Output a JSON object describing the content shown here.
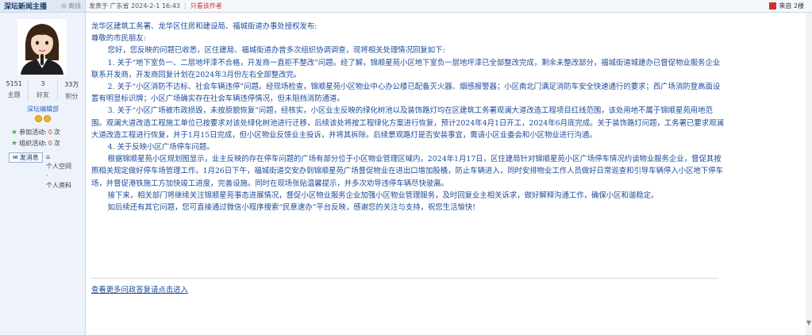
{
  "user": {
    "name": "深坛新闻主播",
    "status": "离线",
    "stats": [
      {
        "value": "5151",
        "label": "主题"
      },
      {
        "value": "3",
        "label": "好友"
      },
      {
        "value": "33万",
        "label": "积分"
      }
    ],
    "rank": "深坛编辑部",
    "activity1_label": "参加活动:",
    "activity1_value": "0",
    "activity1_unit": "次",
    "activity2_label": "组织活动:",
    "activity2_value": "0",
    "activity2_unit": "次",
    "message_button": "发消息",
    "space_link": "个人空间",
    "profile_link": "个人资料"
  },
  "topbar": {
    "posted": "发表于 广东省 2024-2-1 16:43",
    "only_author": "只看该作者",
    "floor": "来自 2楼"
  },
  "post": {
    "lines": [
      "龙华区建筑工务署、龙华区住房和建设局、福城街道办事处授权发布:",
      "尊敬的市民朋友:"
    ],
    "paragraphs": [
      "您好，您反映的问题已收悉，区住建局、福城街道办曾多次组织协调调查，现将相关处理情况回复如下:",
      "1. 关于“地下室负一、二层地坪漆不合格，开发商一直拒不整改”问题。经了解，锦顺星苑小区地下室负一层地坪漆已全部整改完成，剩余未整改部分，福城街道城建办已督促物业服务企业联系开发商，开发商回复计划在2024年3月份左右全部整改完。",
      "2. 关于“小区消防不达标、社会车辆违停”问题。经现场检查，锦顺星苑小区物业中心办公楼已配备灭火器、烟感报警器；小区南北门满足消防车安全快速通行的要求；西广场消防登高面设置有明显标识牌；小区广场确实存在社会车辆违停情况，但未阻挡消防通道。",
      "3. 关于“小区广场被市政损毁，未按原貌恢复”问题，经核实，小区业主反映的绿化树池以及装饰路灯均在区建筑工务署观澜大道改造工程项目红线范围，该处用地不属于锦顺星苑用地范围。观澜大道改造工程施工单位已按要求对该处绿化树池进行迁移，后续该处将按工程绿化方案进行恢复，预计2024年4月1日开工，2024年6月底完成。关于装饰路灯问题，工务署已要求观澜大道改造工程进行恢复，并于1月15日完成，但小区物业反馈业主投诉，并将其拆除。后续景观路灯是否安装事宜，需请小区业委会和小区物业进行沟通。",
      "4. 关于反映小区广场停车问题。",
      "根据锦顺星苑小区规划图显示，业主反映的存在停车问题的广场有部分位于小区物业管理区域内，2024年1月17日，区住建局针对锦顺星苑小区广场停车情况约谈物业服务企业，督促其按照相关规定做好停车场管理工作。1月26日下午，福城街道交安办到锦顺星苑广场督促物业在进出口增加股桶，防止车辆进入，同时安排物业工作人员做好日常巡查和引导车辆停入小区地下停车场，并督促港铁施工方加快竣工进度，完善设施。同时在现场张贴温馨提示，并多次劝导违停车辆尽快驶离。",
      "接下来，相关部门将继续关注锦顺星苑事态进展情况，督促小区物业服务企业加强小区物业管理服务，及时回复业主相关诉求，做好解释沟通工作，确保小区和谐稳定。",
      "如后续还有其它问题，您可直接通过微信小程序搜索“民意速办”平台反映，感谢您的关注与支持，祝您生活愉快!"
    ],
    "more_link": "查看更多问政答复请点击进入"
  },
  "colors": {
    "text_blue": "#1c4a9c",
    "accent_red": "#d0342c",
    "sidebar_bg": "#eef3fb"
  }
}
